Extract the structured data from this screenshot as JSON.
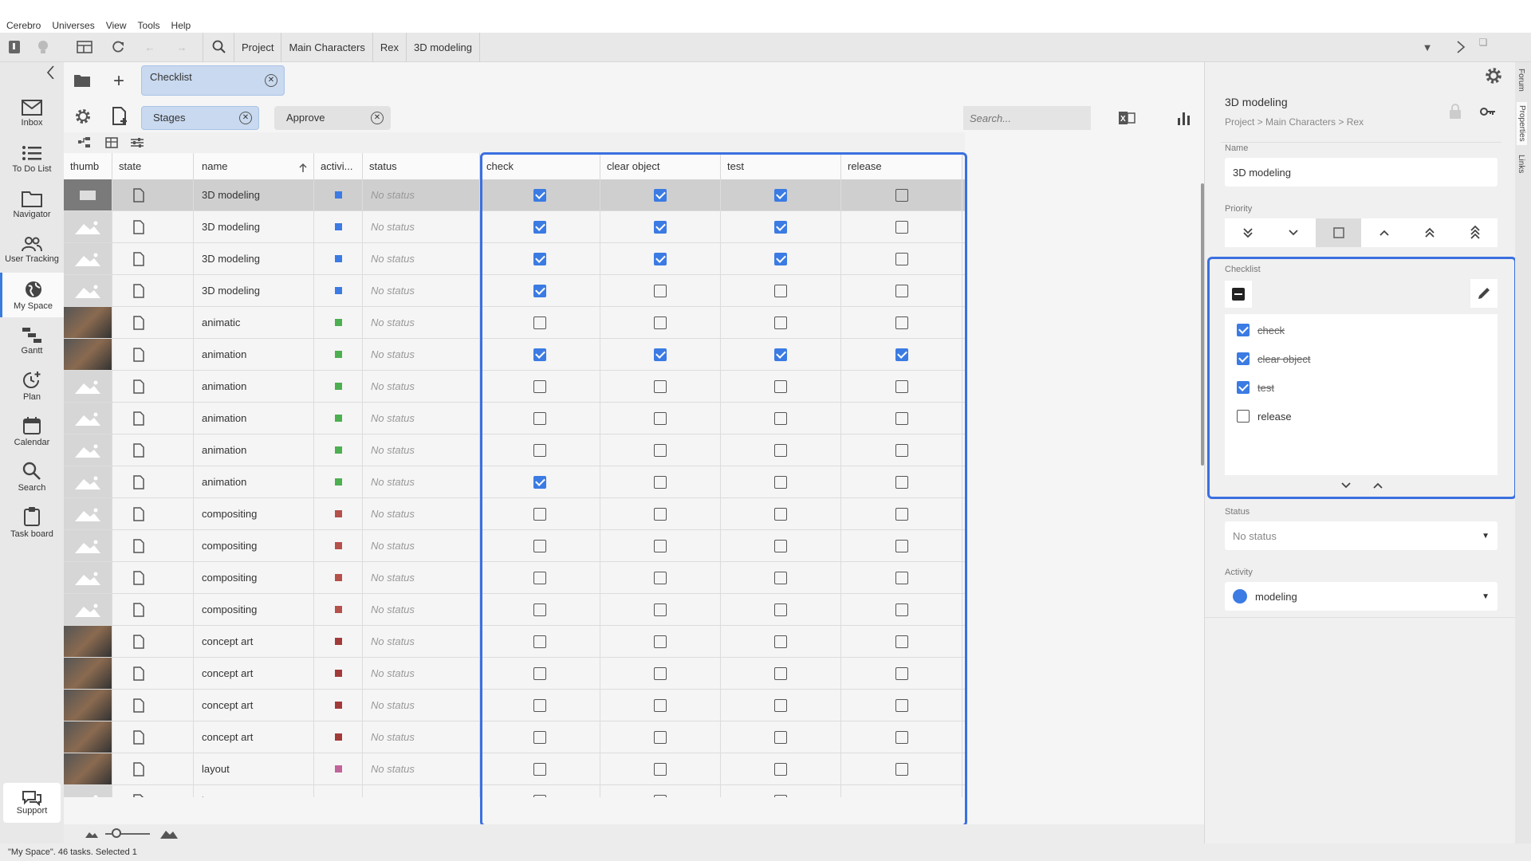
{
  "menu": [
    "Cerebro",
    "Universes",
    "View",
    "Tools",
    "Help"
  ],
  "breadcrumb": [
    "Project",
    "Main Characters",
    "Rex",
    "3D modeling"
  ],
  "sidebar": [
    {
      "label": "Inbox",
      "icon": "mail-icon"
    },
    {
      "label": "To Do List",
      "icon": "list-icon"
    },
    {
      "label": "Navigator",
      "icon": "folder-icon"
    },
    {
      "label": "User Tracking",
      "icon": "users-icon"
    },
    {
      "label": "My Space",
      "icon": "globe-icon"
    },
    {
      "label": "Gantt",
      "icon": "gantt-icon"
    },
    {
      "label": "Plan",
      "icon": "plan-icon"
    },
    {
      "label": "Calendar",
      "icon": "calendar-icon"
    },
    {
      "label": "Search",
      "icon": "search-icon"
    },
    {
      "label": "Task board",
      "icon": "clipboard-icon"
    }
  ],
  "support_label": "Support",
  "tabs": {
    "checklist": "Checklist"
  },
  "filters": {
    "stages": "Stages",
    "approve": "Approve"
  },
  "search": {
    "placeholder": "Search..."
  },
  "columns": {
    "thumb": "thumb",
    "state": "state",
    "name": "name",
    "activity": "activi...",
    "status": "status",
    "check": "check",
    "clear_object": "clear object",
    "test": "test",
    "release": "release"
  },
  "rows": [
    {
      "name": "3D modeling",
      "color": "#3b7be3",
      "thumb": "file",
      "status": "No status",
      "checks": [
        1,
        1,
        1,
        0
      ],
      "selected": true
    },
    {
      "name": "3D modeling",
      "color": "#3b7be3",
      "thumb": "ph",
      "status": "No status",
      "checks": [
        1,
        1,
        1,
        0
      ]
    },
    {
      "name": "3D modeling",
      "color": "#3b7be3",
      "thumb": "ph",
      "status": "No status",
      "checks": [
        1,
        1,
        1,
        0
      ]
    },
    {
      "name": "3D modeling",
      "color": "#3b7be3",
      "thumb": "ph",
      "status": "No status",
      "checks": [
        1,
        0,
        0,
        0
      ]
    },
    {
      "name": "animatic",
      "color": "#4caf50",
      "thumb": "img",
      "status": "No status",
      "checks": [
        0,
        0,
        0,
        0
      ]
    },
    {
      "name": "animation",
      "color": "#4caf50",
      "thumb": "img",
      "status": "No status",
      "checks": [
        1,
        1,
        1,
        1
      ]
    },
    {
      "name": "animation",
      "color": "#4caf50",
      "thumb": "ph",
      "status": "No status",
      "checks": [
        0,
        0,
        0,
        0
      ]
    },
    {
      "name": "animation",
      "color": "#4caf50",
      "thumb": "ph",
      "status": "No status",
      "checks": [
        0,
        0,
        0,
        0
      ]
    },
    {
      "name": "animation",
      "color": "#4caf50",
      "thumb": "ph",
      "status": "No status",
      "checks": [
        0,
        0,
        0,
        0
      ]
    },
    {
      "name": "animation",
      "color": "#4caf50",
      "thumb": "ph",
      "status": "No status",
      "checks": [
        1,
        0,
        0,
        0
      ]
    },
    {
      "name": "compositing",
      "color": "#b5504a",
      "thumb": "ph",
      "status": "No status",
      "checks": [
        0,
        0,
        0,
        0
      ]
    },
    {
      "name": "compositing",
      "color": "#b5504a",
      "thumb": "ph",
      "status": "No status",
      "checks": [
        0,
        0,
        0,
        0
      ]
    },
    {
      "name": "compositing",
      "color": "#b5504a",
      "thumb": "ph",
      "status": "No status",
      "checks": [
        0,
        0,
        0,
        0
      ]
    },
    {
      "name": "compositing",
      "color": "#b5504a",
      "thumb": "ph",
      "status": "No status",
      "checks": [
        0,
        0,
        0,
        0
      ]
    },
    {
      "name": "concept art",
      "color": "#a33a3a",
      "thumb": "img",
      "status": "No status",
      "checks": [
        0,
        0,
        0,
        0
      ]
    },
    {
      "name": "concept art",
      "color": "#a33a3a",
      "thumb": "img",
      "status": "No status",
      "checks": [
        0,
        0,
        0,
        0
      ]
    },
    {
      "name": "concept art",
      "color": "#a33a3a",
      "thumb": "img",
      "status": "No status",
      "checks": [
        0,
        0,
        0,
        0
      ]
    },
    {
      "name": "concept art",
      "color": "#a33a3a",
      "thumb": "img",
      "status": "No status",
      "checks": [
        0,
        0,
        0,
        0
      ]
    },
    {
      "name": "layout",
      "color": "#c0649a",
      "thumb": "img",
      "status": "No status",
      "checks": [
        0,
        0,
        0,
        0
      ]
    },
    {
      "name": "layout",
      "color": "#c0649a",
      "thumb": "ph",
      "status": "No status",
      "checks": [
        0,
        0,
        0,
        null
      ]
    }
  ],
  "statusbar": "\"My Space\". 46 tasks. Selected 1",
  "properties": {
    "title": "3D modeling",
    "path": "Project > Main Characters > Rex",
    "name_label": "Name",
    "name_value": "3D modeling",
    "priority_label": "Priority",
    "priority_active": 2,
    "checklist_label": "Checklist",
    "checklist": [
      {
        "text": "check",
        "done": true
      },
      {
        "text": "clear object",
        "done": true
      },
      {
        "text": "test",
        "done": true
      },
      {
        "text": "release",
        "done": false
      }
    ],
    "status_label": "Status",
    "status_value": "No status",
    "activity_label": "Activity",
    "activity_value": "modeling",
    "activity_color": "#3b7be3"
  },
  "vertical_tabs": [
    "Forum",
    "Properties",
    "Links"
  ],
  "accent": "#3a70e0"
}
